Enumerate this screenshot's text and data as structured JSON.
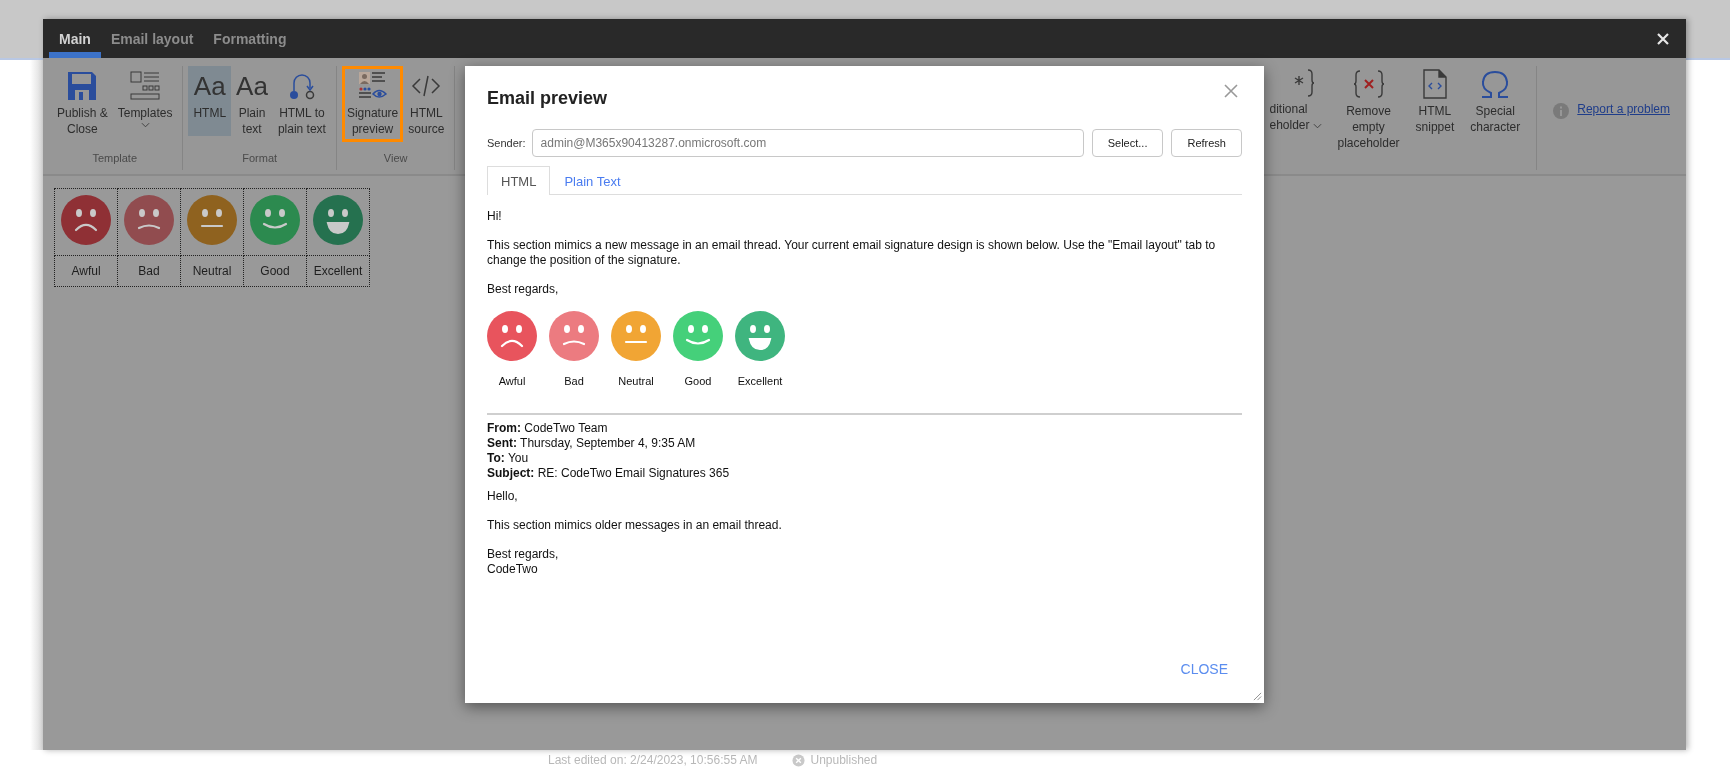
{
  "editor": {
    "tabs": [
      {
        "label": "Main",
        "selected": true
      },
      {
        "label": "Email layout",
        "selected": false
      },
      {
        "label": "Formatting",
        "selected": false
      }
    ],
    "ribbon_groups": [
      {
        "label": "Template",
        "buttons": [
          {
            "kind": "save",
            "lines": [
              "Publish &",
              "Close"
            ],
            "selected": false,
            "highlighted": false,
            "dropdown": false
          },
          {
            "kind": "templates",
            "lines": [
              "Templates"
            ],
            "selected": false,
            "highlighted": false,
            "dropdown": true
          }
        ]
      },
      {
        "label": "Format",
        "buttons": [
          {
            "kind": "font",
            "icon_text": "Aa",
            "lines": [
              "HTML"
            ],
            "selected": true,
            "highlighted": false,
            "dropdown": false
          },
          {
            "kind": "font",
            "icon_text": "Aa",
            "lines": [
              "Plain",
              "text"
            ],
            "selected": false,
            "highlighted": false,
            "dropdown": false
          },
          {
            "kind": "convert",
            "lines": [
              "HTML to",
              "plain text"
            ],
            "selected": false,
            "highlighted": false,
            "dropdown": false
          }
        ]
      },
      {
        "label": "View",
        "buttons": [
          {
            "kind": "signature",
            "lines": [
              "Signature",
              "preview"
            ],
            "selected": false,
            "highlighted": true,
            "dropdown": false
          },
          {
            "kind": "code",
            "lines": [
              "HTML",
              "source"
            ],
            "selected": false,
            "highlighted": false,
            "dropdown": false
          }
        ]
      }
    ],
    "ribbon_tools": [
      {
        "kind": "placeholder",
        "lines": [
          "ditional",
          "eholder"
        ],
        "dropdown": true
      },
      {
        "kind": "remove-placeholder",
        "lines": [
          "Remove",
          "empty",
          "placeholder"
        ],
        "dropdown": false
      },
      {
        "kind": "snippet",
        "lines": [
          "HTML",
          "snippet"
        ],
        "dropdown": false
      },
      {
        "kind": "special",
        "lines": [
          "Special",
          "character"
        ],
        "dropdown": false
      }
    ],
    "report_link": "Report a problem",
    "signature_table": [
      {
        "label": "Awful",
        "kind": "awful",
        "color": "#8f3035"
      },
      {
        "label": "Bad",
        "kind": "bad",
        "color": "#914c4f"
      },
      {
        "label": "Neutral",
        "kind": "neutral",
        "color": "#8f621f"
      },
      {
        "label": "Good",
        "kind": "good",
        "color": "#2c8a4f"
      },
      {
        "label": "Excellent",
        "kind": "excellent",
        "color": "#25714f"
      }
    ]
  },
  "background": {
    "last_edited": "Last edited on: 2/24/2023, 10:56:55 AM",
    "status": "Unpublished"
  },
  "dialog": {
    "title": "Email preview",
    "sender_label": "Sender:",
    "sender_value": "admin@M365x90413287.onmicrosoft.com",
    "buttons": [
      "Select...",
      "Refresh"
    ],
    "tabs": [
      {
        "label": "HTML",
        "selected": true
      },
      {
        "label": "Plain Text",
        "selected": false
      }
    ],
    "greeting": "Hi!",
    "intro": "This section mimics a new message in an email thread. Your current email signature design is shown below. Use the \"Email layout\" tab to change the position of the signature.",
    "closing": "Best regards,",
    "signature": [
      {
        "label": "Awful",
        "kind": "awful",
        "color": "#e8545d"
      },
      {
        "label": "Bad",
        "kind": "bad",
        "color": "#ec7b80"
      },
      {
        "label": "Neutral",
        "kind": "neutral",
        "color": "#f1a534"
      },
      {
        "label": "Good",
        "kind": "good",
        "color": "#45d07a"
      },
      {
        "label": "Excellent",
        "kind": "excellent",
        "color": "#3fb57f"
      }
    ],
    "quoted_headers": [
      "**From:** CodeTwo Team",
      "**Sent:** Thursday, September 4, 9:35 AM",
      "**To:** You",
      "**Subject:** RE: CodeTwo Email Signatures 365"
    ],
    "quoted_paragraphs": [
      "Hello,",
      "This section mimics older messages in an email thread."
    ],
    "quoted_signoff": [
      "Best regards,",
      "CodeTwo"
    ],
    "close_button": "CLOSE"
  }
}
